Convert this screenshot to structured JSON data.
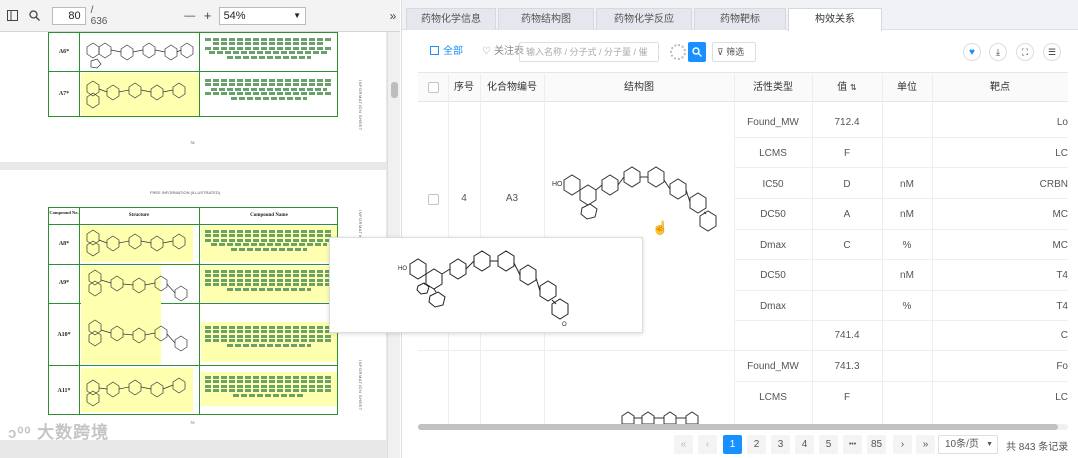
{
  "pdf_viewer": {
    "current_page": "80",
    "total_pages": "/ 636",
    "zoom": "54%",
    "zoom_minus": "—",
    "zoom_plus": "+",
    "page_footer_1": "78",
    "page_footer_2": "79",
    "page_header_2": "FREE INFORMATION (ILLUSTRATED)",
    "side_text": "INFORMATION SHEET",
    "compound_no_header": "Compound No.",
    "structure_header": "Structure",
    "compound_name_header": "Compound Name",
    "compound_ids_page1": [
      "A6*",
      "A7*"
    ],
    "compound_ids_page2": [
      "A8*",
      "A9*",
      "A10*",
      "A11*"
    ]
  },
  "tabs": [
    "药物化学信息",
    "药物结构图",
    "药物化学反应",
    "药物靶标",
    "构效关系"
  ],
  "active_tab": 4,
  "toolbar": {
    "all_label": "全部",
    "follow_label": "关注表",
    "search_placeholder": "输入名称 / 分子式 / 分子量 / 催",
    "filter_label": "筛选"
  },
  "table": {
    "headers": [
      "序号",
      "化合物编号",
      "结构图",
      "活性类型",
      "值",
      "单位",
      "靶点"
    ],
    "row": {
      "seq": "4",
      "compound_id": "A3",
      "activities": [
        {
          "type": "Found_MW",
          "value": "712.4",
          "unit": "",
          "target": "Lo"
        },
        {
          "type": "LCMS",
          "value": "F",
          "unit": "",
          "target": "LC"
        },
        {
          "type": "IC50",
          "value": "D",
          "unit": "nM",
          "target": "CRBN"
        },
        {
          "type": "DC50",
          "value": "A",
          "unit": "nM",
          "target": "MC"
        },
        {
          "type": "Dmax",
          "value": "C",
          "unit": "%",
          "target": "MC"
        },
        {
          "type": "DC50",
          "value": "",
          "unit": "nM",
          "target": "T4"
        },
        {
          "type": "Dmax",
          "value": "",
          "unit": "%",
          "target": "T4"
        },
        {
          "type": "",
          "value": "741.4",
          "unit": "",
          "target": "C"
        },
        {
          "type": "Found_MW",
          "value": "741.3",
          "unit": "",
          "target": "Fo"
        },
        {
          "type": "LCMS",
          "value": "F",
          "unit": "",
          "target": "LC"
        }
      ]
    }
  },
  "pagination": {
    "pages": [
      "1",
      "2",
      "3",
      "4",
      "5",
      "•••",
      "85"
    ],
    "current": "1",
    "page_size": "10条/页",
    "total": "共 843 条记录"
  },
  "watermark": "大数跨境",
  "colors": {
    "accent": "#1890ff",
    "pdf_green": "#2f8f2f",
    "highlight": "#ffffb0"
  }
}
